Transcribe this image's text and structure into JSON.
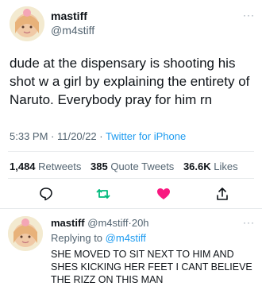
{
  "tweet": {
    "author": {
      "name": "mastiff",
      "handle": "@m4stiff"
    },
    "more_label": "···",
    "text": "dude at the dispensary is shooting his shot w a girl by explaining the entirety of Naruto. Everybody pray for him rn",
    "time": "5:33 PM",
    "date": "11/20/22",
    "separator": "·",
    "source": "Twitter for iPhone",
    "stats": {
      "retweets_count": "1,484",
      "retweets_label": "Retweets",
      "quotes_count": "385",
      "quotes_label": "Quote Tweets",
      "likes_count": "36.6K",
      "likes_label": "Likes"
    },
    "actions": {
      "reply_icon": "comment-icon",
      "retweet_icon": "retweet-icon",
      "like_icon": "heart-icon",
      "share_icon": "share-icon",
      "liked": true
    }
  },
  "reply": {
    "author": {
      "name": "mastiff",
      "handle": "@m4stiff"
    },
    "separator": "·",
    "time": "20h",
    "more_label": "···",
    "replying_prefix": "Replying to",
    "replying_to": "@m4stiff",
    "text": "SHE MOVED TO SIT NEXT TO HIM AND SHES KICKING HER FEET I CANT BELIEVE THE RIZZ ON THIS MAN"
  },
  "colors": {
    "accent": "#1d9bf0",
    "retweet": "#00ba7c",
    "like": "#f91880",
    "secondary_text": "#536471"
  }
}
